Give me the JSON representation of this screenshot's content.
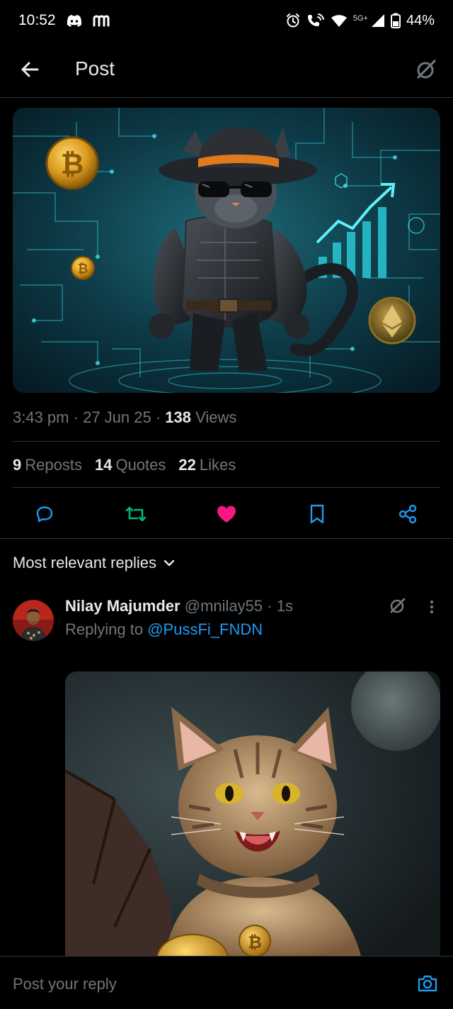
{
  "status_bar": {
    "time": "10:52",
    "network_label": "5G+",
    "battery": "44%",
    "left_icons": [
      "discord-icon",
      "m-app-icon"
    ],
    "right_icons": [
      "alarm-icon",
      "wifi-calling-icon",
      "wifi-icon",
      "signal-icon",
      "battery-icon"
    ]
  },
  "header": {
    "title": "Post"
  },
  "post": {
    "time": "3:43 pm",
    "date": "27 Jun 25",
    "views_count": "138",
    "views_label": "Views",
    "separator": "·",
    "reposts_count": "9",
    "reposts_label": "Reposts",
    "quotes_count": "14",
    "quotes_label": "Quotes",
    "likes_count": "22",
    "likes_label": "Likes"
  },
  "actions": {
    "liked": true,
    "reposted": true
  },
  "replies": {
    "sort_label": "Most relevant replies",
    "items": [
      {
        "name": "Nilay Majumder",
        "handle": "@mnilay55",
        "time": "1s",
        "replying_to_label": "Replying to",
        "replying_to": "@PussFi_FNDN"
      }
    ]
  },
  "composer": {
    "placeholder": "Post your reply"
  },
  "colors": {
    "background": "#000000",
    "text": "#e7e9ea",
    "muted": "#71767b",
    "accent_blue": "#1d9bf0",
    "like_pink": "#f91880",
    "repost_green": "#00ba7c",
    "divider": "#2f3336"
  }
}
